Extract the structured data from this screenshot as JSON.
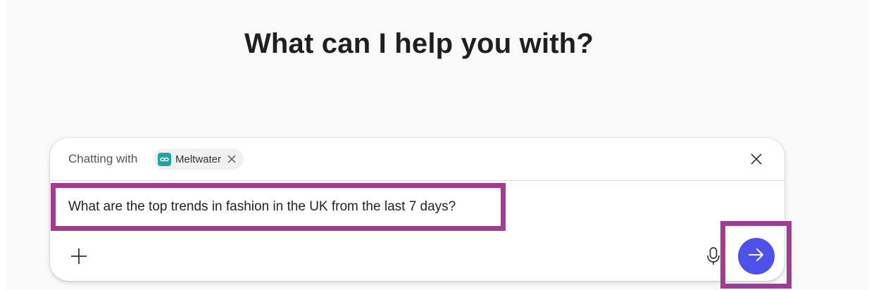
{
  "heading": "What can I help you with?",
  "chat": {
    "chatting_label": "Chatting with",
    "agent": {
      "name": "Meltwater",
      "logo_color": "#1fa3a3",
      "icon": "meltwater-logo-icon"
    },
    "prompt_text": "What are the top trends in fashion in the UK from the last 7 days?",
    "icons": {
      "chip_remove": "close-icon",
      "header_close": "close-icon",
      "add": "plus-icon",
      "mic": "microphone-icon",
      "send": "arrow-right-icon"
    }
  },
  "colors": {
    "send_button": "#4f52e8",
    "highlight": "#a23b92",
    "background": "#f9f9f9"
  }
}
